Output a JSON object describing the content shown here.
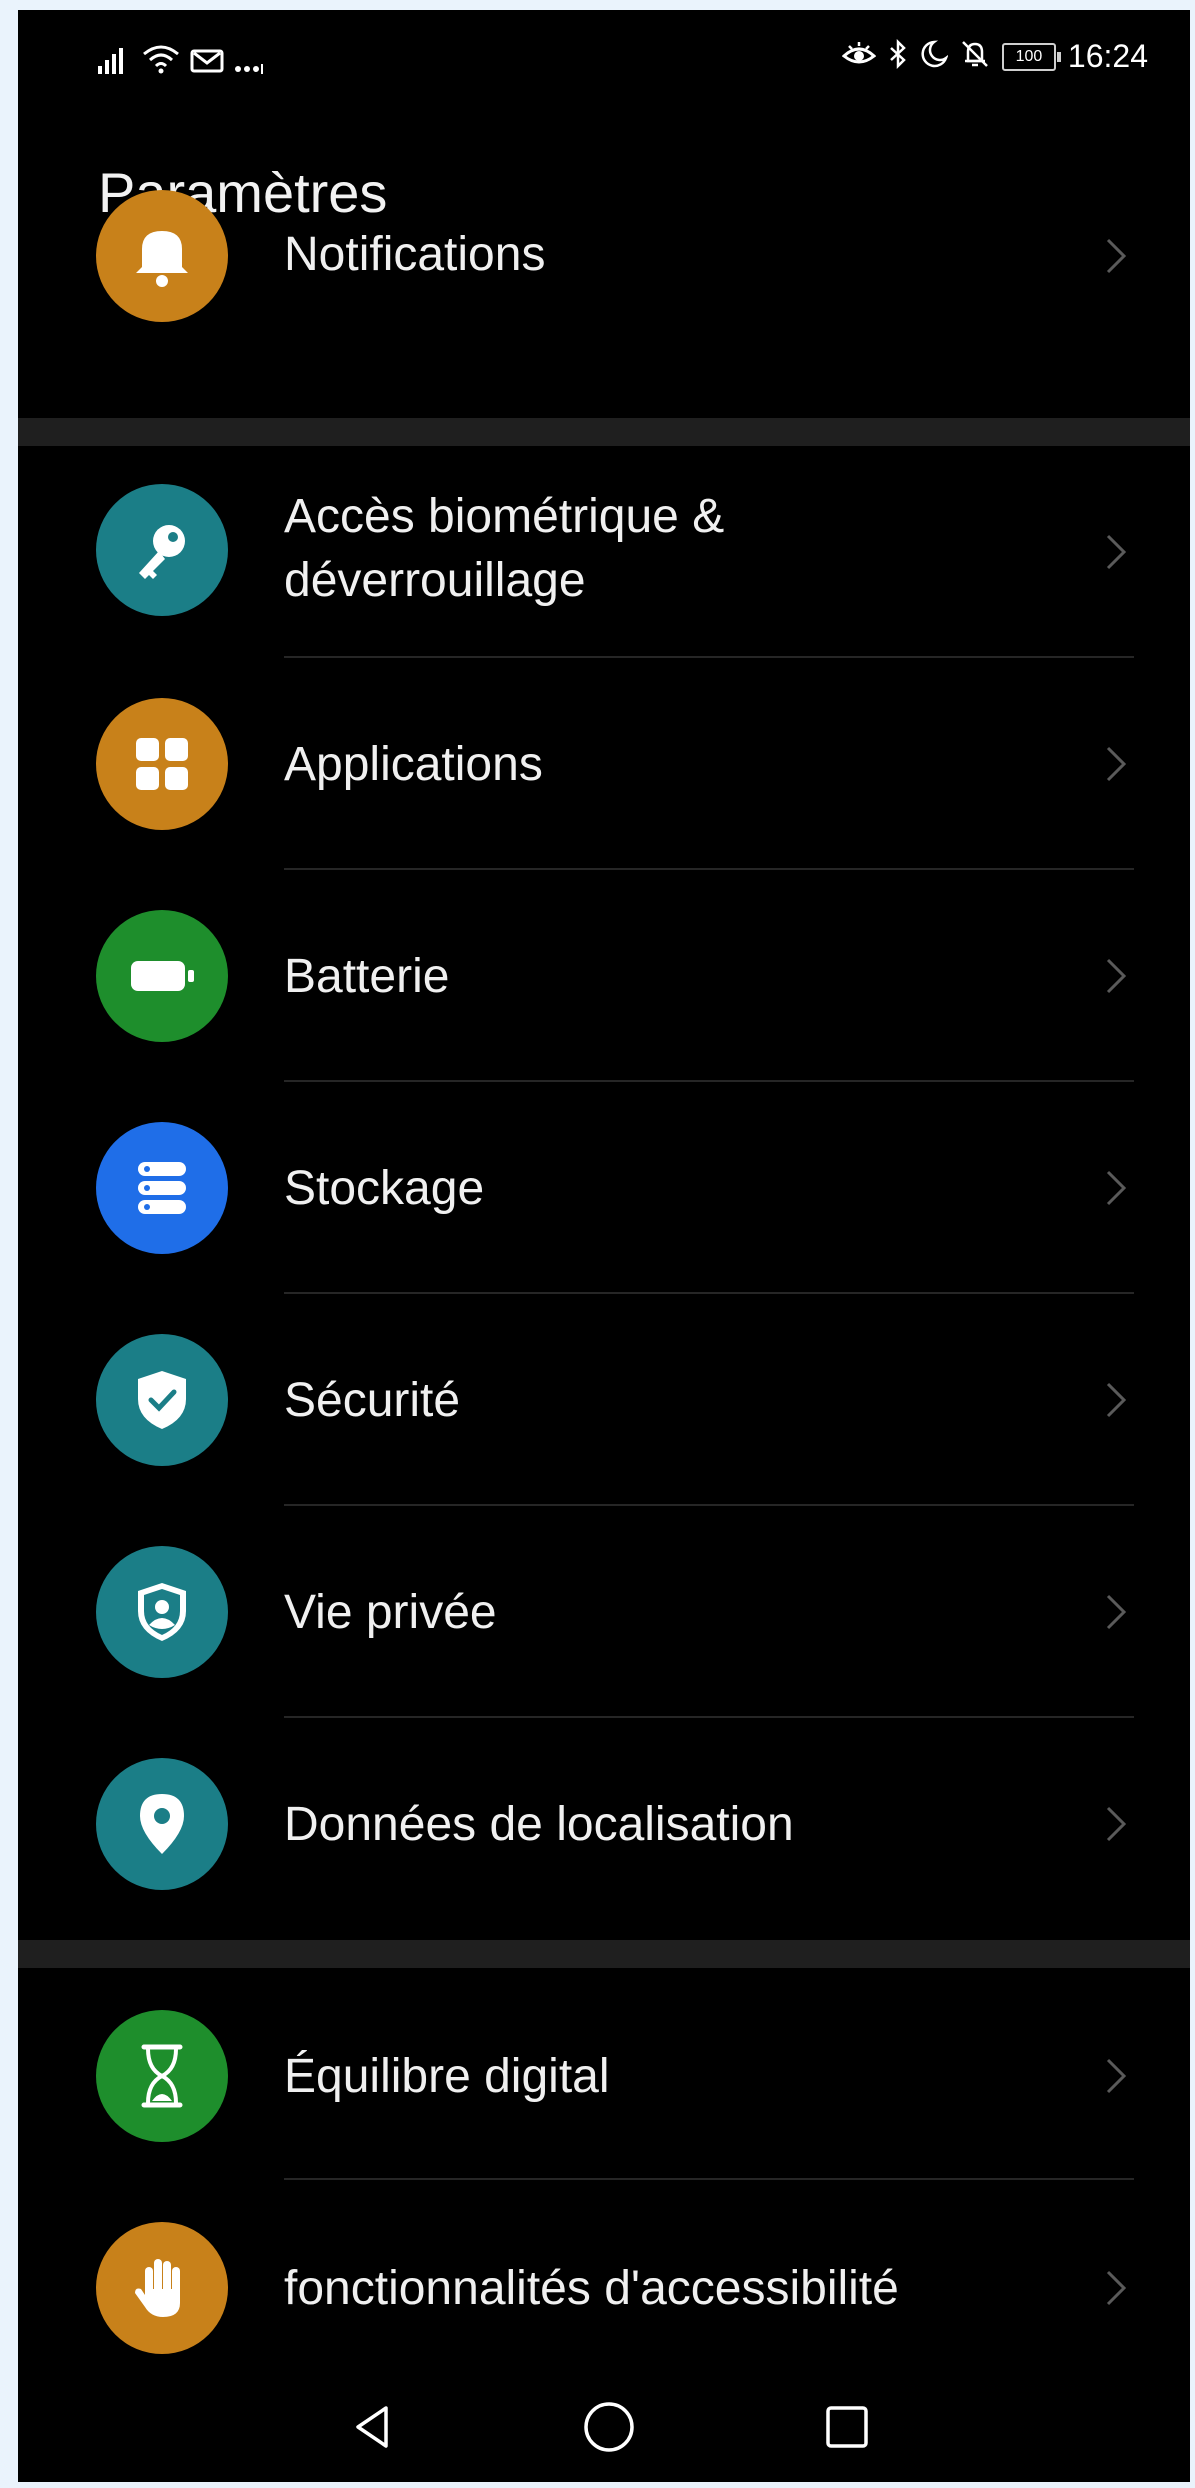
{
  "status_bar": {
    "time": "16:24",
    "battery_level": "100",
    "left_icons": [
      "signal-icon",
      "wifi-icon",
      "message-icon",
      "more-dots-icon"
    ],
    "right_icons": [
      "eye-comfort-icon",
      "bluetooth-icon",
      "do-not-disturb-icon",
      "notifications-off-icon"
    ]
  },
  "header": {
    "title": "Paramètres"
  },
  "settings": {
    "notifications": {
      "label": "Notifications",
      "icon": "bell-icon",
      "color": "#c8811a"
    },
    "biometrics": {
      "label_line1": "Accès biométrique &",
      "label_line2": "déverrouillage",
      "icon": "key-icon",
      "color": "#1b7e87"
    },
    "applications": {
      "label": "Applications",
      "icon": "apps-grid-icon",
      "color": "#c8811a"
    },
    "battery": {
      "label": "Batterie",
      "icon": "battery-icon",
      "color": "#1e8e2c"
    },
    "storage": {
      "label": "Stockage",
      "icon": "storage-icon",
      "color": "#1f6ee8"
    },
    "security": {
      "label": "Sécurité",
      "icon": "shield-check-icon",
      "color": "#1b7e87"
    },
    "privacy": {
      "label": "Vie privée",
      "icon": "privacy-icon",
      "color": "#1b7e87"
    },
    "location": {
      "label": "Données de localisation",
      "icon": "location-pin-icon",
      "color": "#1b7e87"
    },
    "digital_balance": {
      "label": "Équilibre digital",
      "icon": "hourglass-icon",
      "color": "#1e8e2c"
    },
    "accessibility": {
      "label": "fonctionnalités d'accessibilité",
      "icon": "hand-icon",
      "color": "#c8811a"
    }
  },
  "nav_bar": {
    "buttons": [
      "back-icon",
      "home-icon",
      "recents-icon"
    ]
  }
}
